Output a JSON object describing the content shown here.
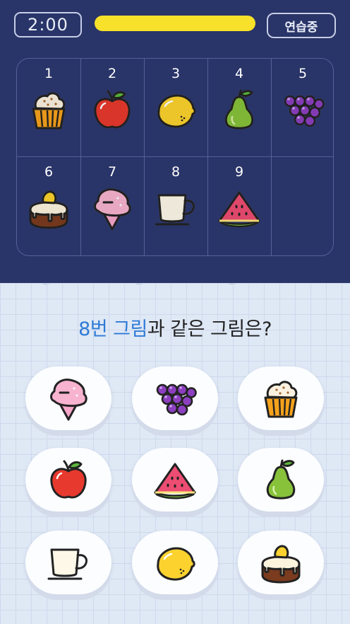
{
  "header": {
    "timer": "2:00",
    "progress": 1.0,
    "mode_label": "연습중"
  },
  "board": {
    "cells": [
      {
        "number": "1",
        "icon": "cupcake-icon"
      },
      {
        "number": "2",
        "icon": "apple-icon"
      },
      {
        "number": "3",
        "icon": "lemon-icon"
      },
      {
        "number": "4",
        "icon": "pear-icon"
      },
      {
        "number": "5",
        "icon": "grapes-icon"
      },
      {
        "number": "6",
        "icon": "cake-icon"
      },
      {
        "number": "7",
        "icon": "ice-cream-icon"
      },
      {
        "number": "8",
        "icon": "cup-icon"
      },
      {
        "number": "9",
        "icon": "watermelon-icon"
      }
    ]
  },
  "question": {
    "highlight": "8번 그림",
    "rest": "과 같은 그림은?"
  },
  "options": [
    {
      "icon": "ice-cream-icon"
    },
    {
      "icon": "grapes-icon"
    },
    {
      "icon": "cupcake-icon"
    },
    {
      "icon": "apple-icon"
    },
    {
      "icon": "watermelon-icon"
    },
    {
      "icon": "pear-icon"
    },
    {
      "icon": "cup-icon"
    },
    {
      "icon": "lemon-icon"
    },
    {
      "icon": "cake-icon"
    }
  ],
  "colors": {
    "top_background": "#293468",
    "progress_bar": "#f7e12a",
    "highlight_text": "#2f7ad6",
    "page_background": "#dfe8f5"
  }
}
